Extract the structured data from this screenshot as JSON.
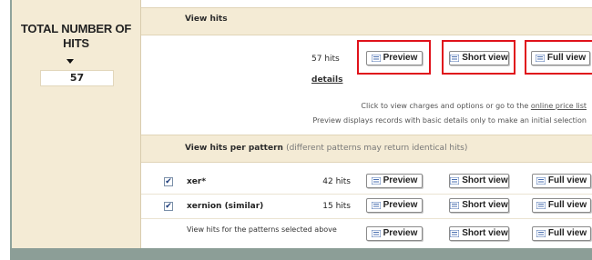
{
  "left": {
    "title": "TOTAL NUMBER OF HITS",
    "count": "57"
  },
  "view_hits": {
    "header": "View hits",
    "hits": "57 hits",
    "details_link": "details",
    "info_text": "Click to view charges and options or go to the",
    "price_link": "online price list",
    "preview_text": "Preview displays records with basic details only to make an initial selection",
    "buttons": {
      "preview": "Preview",
      "short_view": "Short view",
      "full_view": "Full view"
    }
  },
  "pattern_section": {
    "header": "View hits per pattern",
    "note": "(different patterns may return identical hits)",
    "rows": [
      {
        "pattern": "xer*",
        "hits": "42 hits",
        "checked": true
      },
      {
        "pattern": "xernion (similar)",
        "hits": "15 hits",
        "checked": true
      }
    ],
    "selected_text": "View hits for the patterns selected above",
    "buttons": {
      "preview": "Preview",
      "short_view": "Short view",
      "full_view": "Full view"
    }
  },
  "icons": {
    "button_icon": "record-list-icon",
    "check": "✔"
  },
  "colors": {
    "highlight": "#e0121b",
    "panel": "#f4ebd5"
  }
}
